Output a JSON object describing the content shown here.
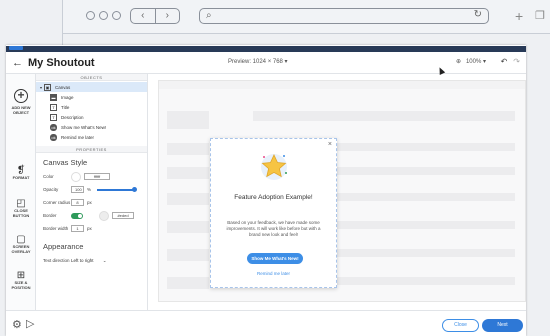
{
  "browser": {
    "nav_back": "‹",
    "nav_forward": "›",
    "new_tab": "+",
    "tabs_icon": "tabs-icon"
  },
  "app": {
    "title": "My Shoutout",
    "back_icon": "←",
    "preview_label": "Preview:  1024 × 768  ▾",
    "zoom_label": "100%  ▾",
    "zoom_icon": "⊕",
    "undo_icon": "↶",
    "redo_icon": "↷"
  },
  "rail": {
    "add_new_object": "ADD NEW OBJECT",
    "format": "FORMAT",
    "close_button": "CLOSE BUTTON",
    "screen_overlay": "SCREEN OVERLAY",
    "size_position": "SIZE & POSITION"
  },
  "objects": {
    "header": "OBJECTS",
    "root": "Canvas",
    "children": [
      "Image",
      "Title",
      "Description",
      "Show me What's New!",
      "Remind me later"
    ]
  },
  "properties": {
    "header": "PROPERTIES",
    "section": "Canvas Style",
    "color_label": "Color",
    "color_value": "ffffff",
    "opacity_label": "Opacity",
    "opacity_value": "100",
    "opacity_unit": "%",
    "radius_label": "Corner radius",
    "radius_value": "8",
    "radius_unit": "px",
    "border_label": "Border",
    "border_color_value": "#eded",
    "border_width_label": "Border width",
    "border_width_value": "1",
    "border_width_unit": "px",
    "appearance_section": "Appearance",
    "text_direction_label": "Text direction",
    "text_direction_value": "Left to right"
  },
  "modal": {
    "title": "Feature Adoption Example!",
    "description": "Based on your feedback, we have made some improvements. It will work like before but with a brand new look and feel!",
    "primary_button": "Show Me What's New!",
    "secondary_link": "Remind me later",
    "close_icon": "×"
  },
  "footer": {
    "close_label": "Close",
    "next_label": "Next"
  },
  "colors": {
    "accent": "#2e78d6",
    "toggle": "#2e9a5b",
    "header_strip": "#283a57"
  }
}
